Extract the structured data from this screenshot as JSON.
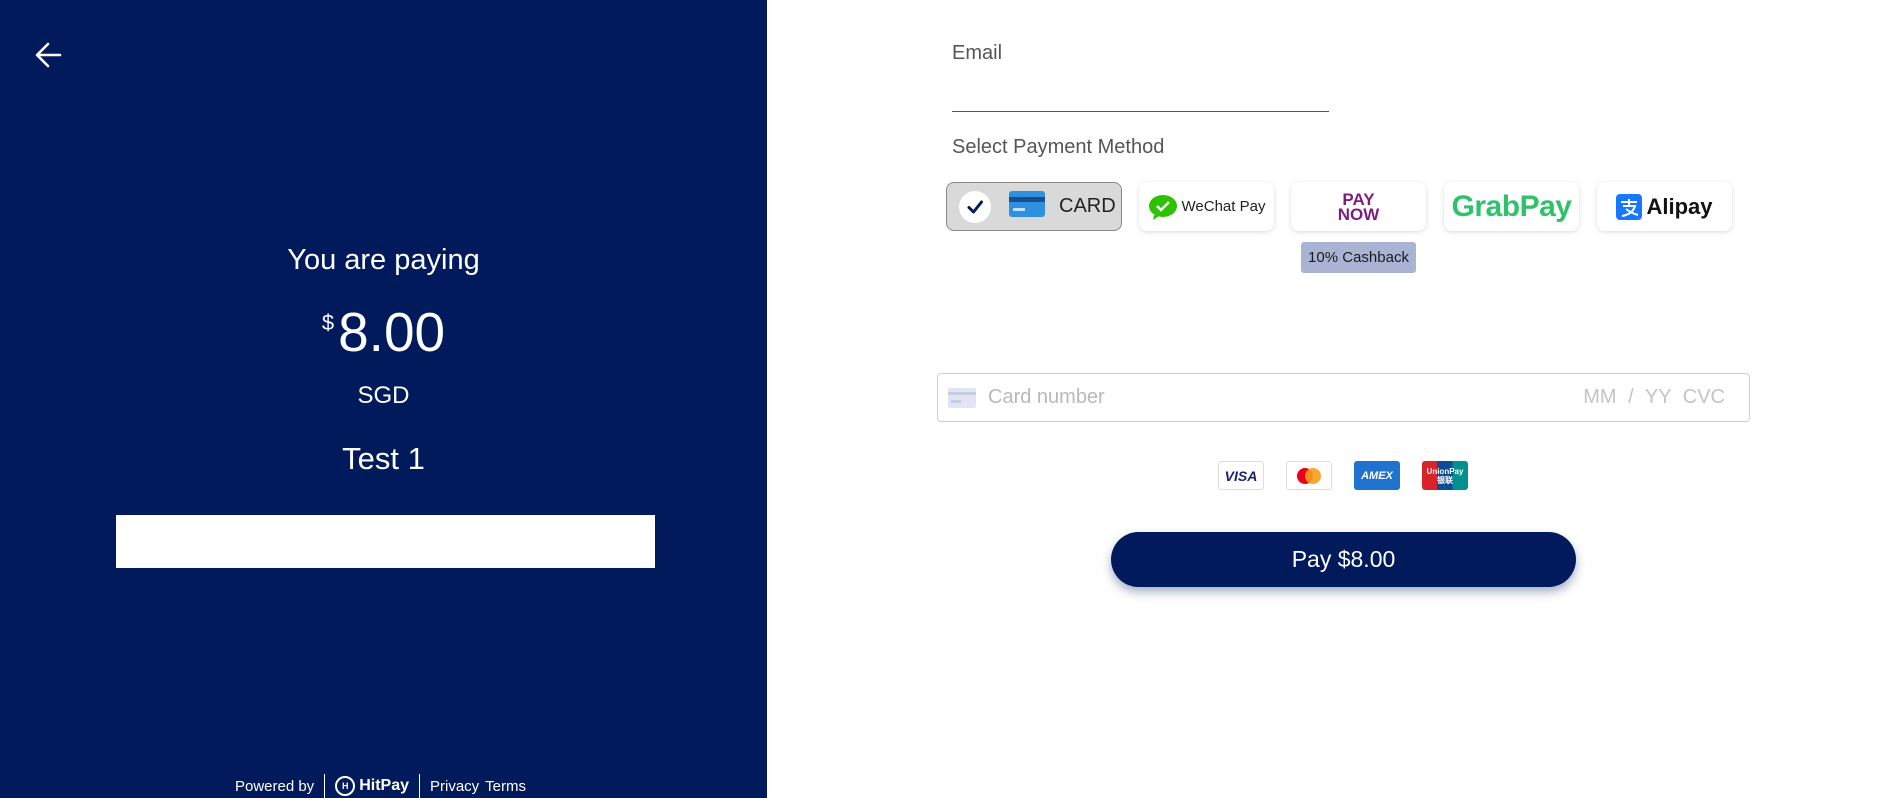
{
  "left": {
    "paying_label": "You are paying",
    "currency_symbol": "$",
    "amount": "8.00",
    "currency": "SGD",
    "merchant_name": "Test 1",
    "back_icon": "arrow-left-icon",
    "footer": {
      "powered_by": "Powered by",
      "brand": "HitPay",
      "privacy": "Privacy",
      "terms": "Terms"
    }
  },
  "right": {
    "email_label": "Email",
    "email_value": "",
    "method_label": "Select Payment Method",
    "methods": {
      "card": "CARD",
      "wechat": "WeChat Pay",
      "paynow_top": "PAY",
      "paynow_bottom": "NOW",
      "grab": "GrabPay",
      "alipay": "Alipay"
    },
    "cashback_badge": "10% Cashback",
    "card_number_placeholder": "Card number",
    "card_expiry_cvc_placeholder": "MM / YY CVC",
    "brands": {
      "visa": "VISA",
      "amex": "AMEX",
      "unionpay": "UnionPay 银联"
    },
    "pay_button": "Pay $8.00"
  },
  "colors": {
    "primary": "#001a5c",
    "cashback_bg": "#a9b4d4",
    "grab_green": "#2fc26a",
    "paynow_purple": "#7b1d7e"
  }
}
